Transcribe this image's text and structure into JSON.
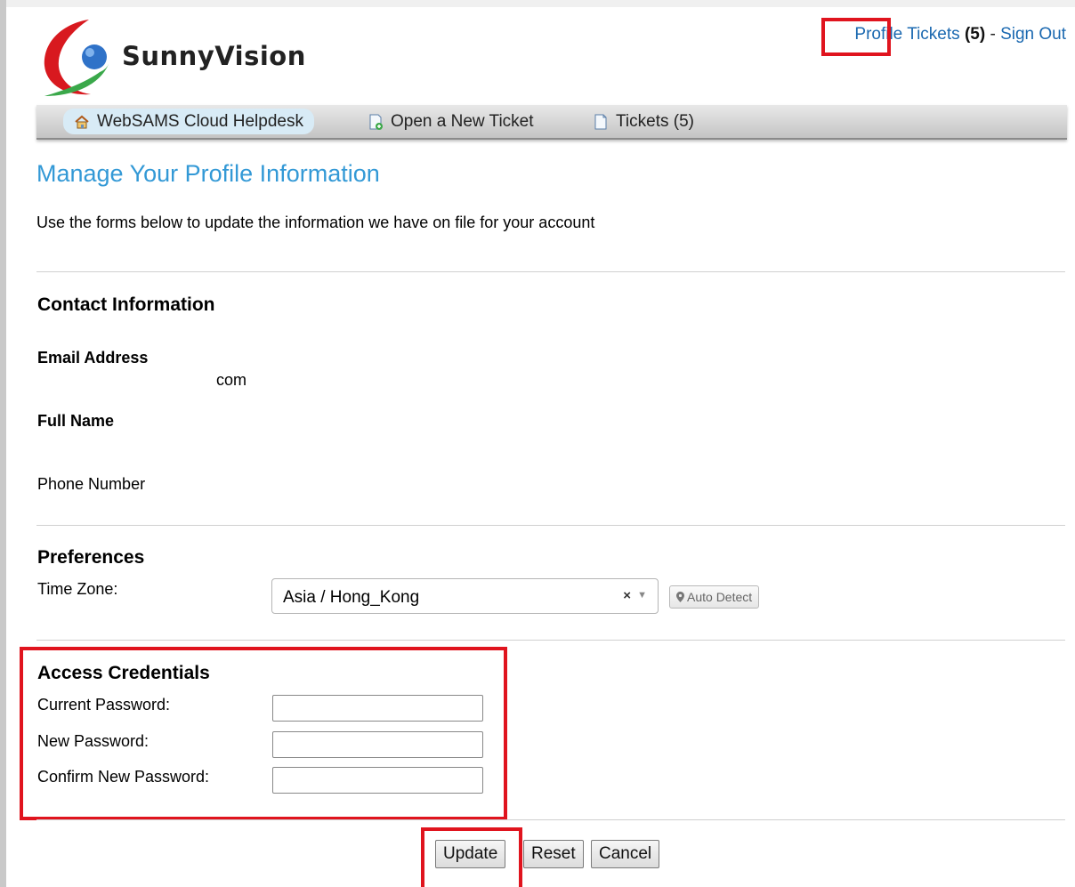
{
  "brand": {
    "name": "SunnyVision"
  },
  "top_links": {
    "profile": "Profile",
    "tickets": "Tickets",
    "tickets_count": "(5)",
    "separator": "-",
    "sign_out": "Sign Out"
  },
  "nav": {
    "items": [
      {
        "label": "WebSAMS Cloud Helpdesk",
        "icon": "home-icon"
      },
      {
        "label": "Open a New Ticket",
        "icon": "new-ticket-icon"
      },
      {
        "label": "Tickets (5)",
        "icon": "tickets-icon"
      }
    ]
  },
  "page": {
    "title": "Manage Your Profile Information",
    "subtitle": "Use the forms below to update the information we have on file for your account"
  },
  "contact": {
    "heading": "Contact Information",
    "email_label": "Email Address",
    "email_value": "com",
    "fullname_label": "Full Name",
    "phone_label": "Phone Number"
  },
  "preferences": {
    "heading": "Preferences",
    "timezone_label": "Time Zone:",
    "timezone_value": "Asia / Hong_Kong",
    "clear_glyph": "×",
    "auto_detect": "Auto Detect"
  },
  "credentials": {
    "heading": "Access Credentials",
    "current_label": "Current Password:",
    "new_label": "New Password:",
    "confirm_label": "Confirm New Password:"
  },
  "buttons": {
    "update": "Update",
    "reset": "Reset",
    "cancel": "Cancel"
  },
  "colors": {
    "accent": "#3399d6",
    "link": "#1a68b0",
    "highlight": "#e0141e"
  }
}
